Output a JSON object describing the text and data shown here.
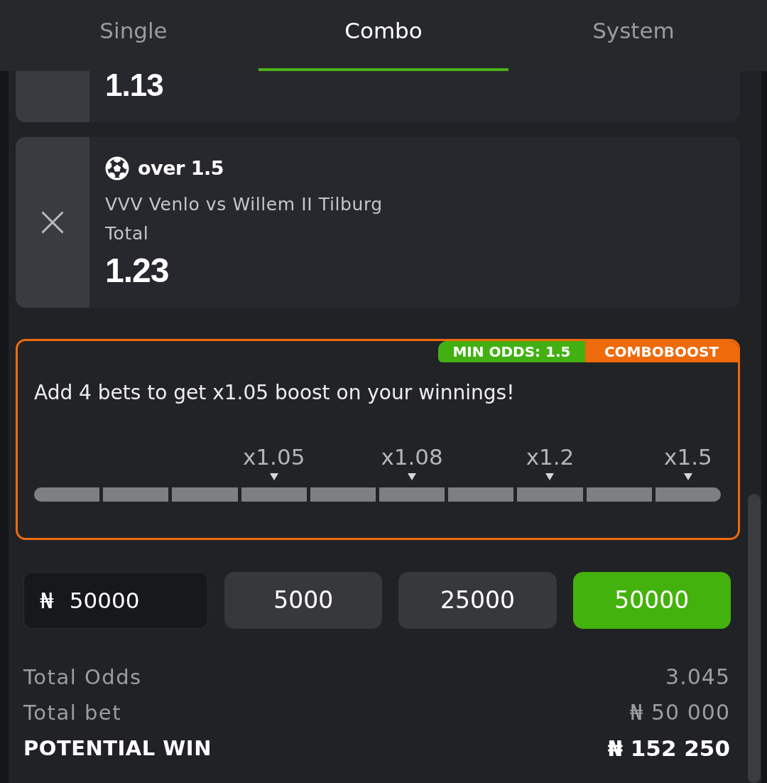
{
  "tabs": [
    {
      "label": "Single",
      "selected": false
    },
    {
      "label": "Combo",
      "selected": true
    },
    {
      "label": "System",
      "selected": false
    }
  ],
  "bets": [
    {
      "kind": "cut",
      "odds": "1.13"
    },
    {
      "kind": "full",
      "selection": "over 1.5",
      "match": "VVV Venlo vs Willem II Tilburg",
      "market": "Total",
      "odds": "1.23"
    }
  ],
  "combo_boost": {
    "badges": [
      {
        "label": "MIN ODDS: 1.5",
        "color": "#43b012"
      },
      {
        "label": "COMBOBOOST",
        "color": "#ee6a0b"
      }
    ],
    "message": "Add 4 bets to get x1.05 boost on your winnings!",
    "segments": [
      {
        "filled": false
      },
      {
        "filled": false
      },
      {
        "filled": false
      },
      {
        "filled": false,
        "label": "x1.05"
      },
      {
        "filled": false
      },
      {
        "filled": false,
        "label": "x1.08"
      },
      {
        "filled": false
      },
      {
        "filled": false,
        "label": "x1.2"
      },
      {
        "filled": false
      },
      {
        "filled": false,
        "label": "x1.5"
      }
    ]
  },
  "stake": {
    "currency": "₦",
    "value": "50000"
  },
  "quick_amounts": [
    {
      "label": "5000",
      "selected": false
    },
    {
      "label": "25000",
      "selected": false
    },
    {
      "label": "50000",
      "selected": true
    }
  ],
  "summary": [
    {
      "kind": "normal",
      "label": "Total Odds",
      "value": "3.045"
    },
    {
      "kind": "normal",
      "label": "Total bet",
      "value": "₦ 50 000"
    },
    {
      "kind": "highlight",
      "label": "POTENTIAL WIN",
      "value": "₦ 152 250"
    }
  ]
}
